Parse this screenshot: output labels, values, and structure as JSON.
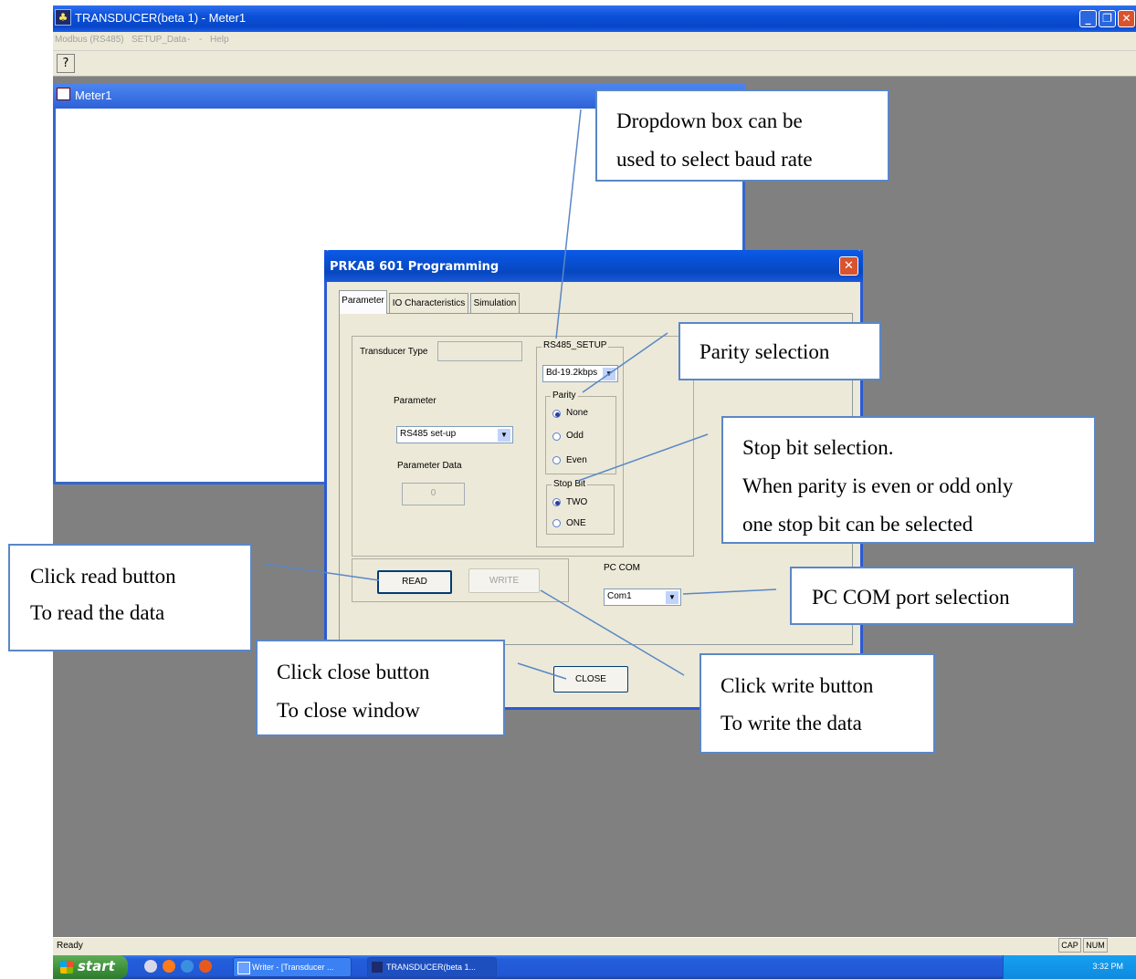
{
  "app": {
    "title": "TRANSDUCER(beta 1) - Meter1",
    "menu": [
      "Modbus (RS485)",
      "SETUP_Data",
      "-",
      "-",
      "Help"
    ],
    "toolbar_help_icon": "?",
    "status_text": "Ready",
    "indicators": [
      "CAP",
      "NUM"
    ]
  },
  "child_window": {
    "title": "Meter1"
  },
  "dialog": {
    "title": "PRKAB 601 Programming",
    "tabs": [
      "Parameter",
      "IO Characteristics",
      "Simulation"
    ],
    "transducer_type_label": "Transducer Type",
    "parameter_label": "Parameter",
    "parameter_value": "RS485 set-up",
    "parameter_data_label": "Parameter Data",
    "parameter_data_value": "0",
    "rs485_group_title": "RS485_SETUP",
    "baud_value": "Bd-19.2kbps",
    "parity_group_title": "Parity",
    "parity_options": [
      "None",
      "Odd",
      "Even"
    ],
    "parity_selected": "None",
    "stopbit_group_title": "Stop Bit",
    "stopbit_options": [
      "TWO",
      "ONE"
    ],
    "stopbit_selected": "TWO",
    "read_label": "READ",
    "write_label": "WRITE",
    "pc_com_label": "PC COM",
    "pc_com_value": "Com1",
    "close_label": "CLOSE"
  },
  "callouts": {
    "baud": [
      "Dropdown  box  can  be",
      "used to select baud rate"
    ],
    "parity": [
      "Parity selection"
    ],
    "stopbit": [
      "Stop bit selection.",
      "When parity is even or odd only",
      "one stop bit can be selected"
    ],
    "read": [
      "Click read button",
      "To read the data"
    ],
    "pccom": [
      "PC COM port selection"
    ],
    "close": [
      "Click close button",
      "To close window"
    ],
    "write": [
      "Click write button",
      "To write the data"
    ]
  },
  "taskbar": {
    "start_label": "start",
    "items": [
      "Writer - [Transducer ...",
      "TRANSDUCER(beta 1..."
    ],
    "clock": "3:32 PM"
  },
  "colors": {
    "title_blue": "#0a50d8",
    "desktop_gray": "#808080",
    "dialog_face": "#ece9d8",
    "close_red": "#d9532e",
    "callout_border": "#5a87c6"
  }
}
